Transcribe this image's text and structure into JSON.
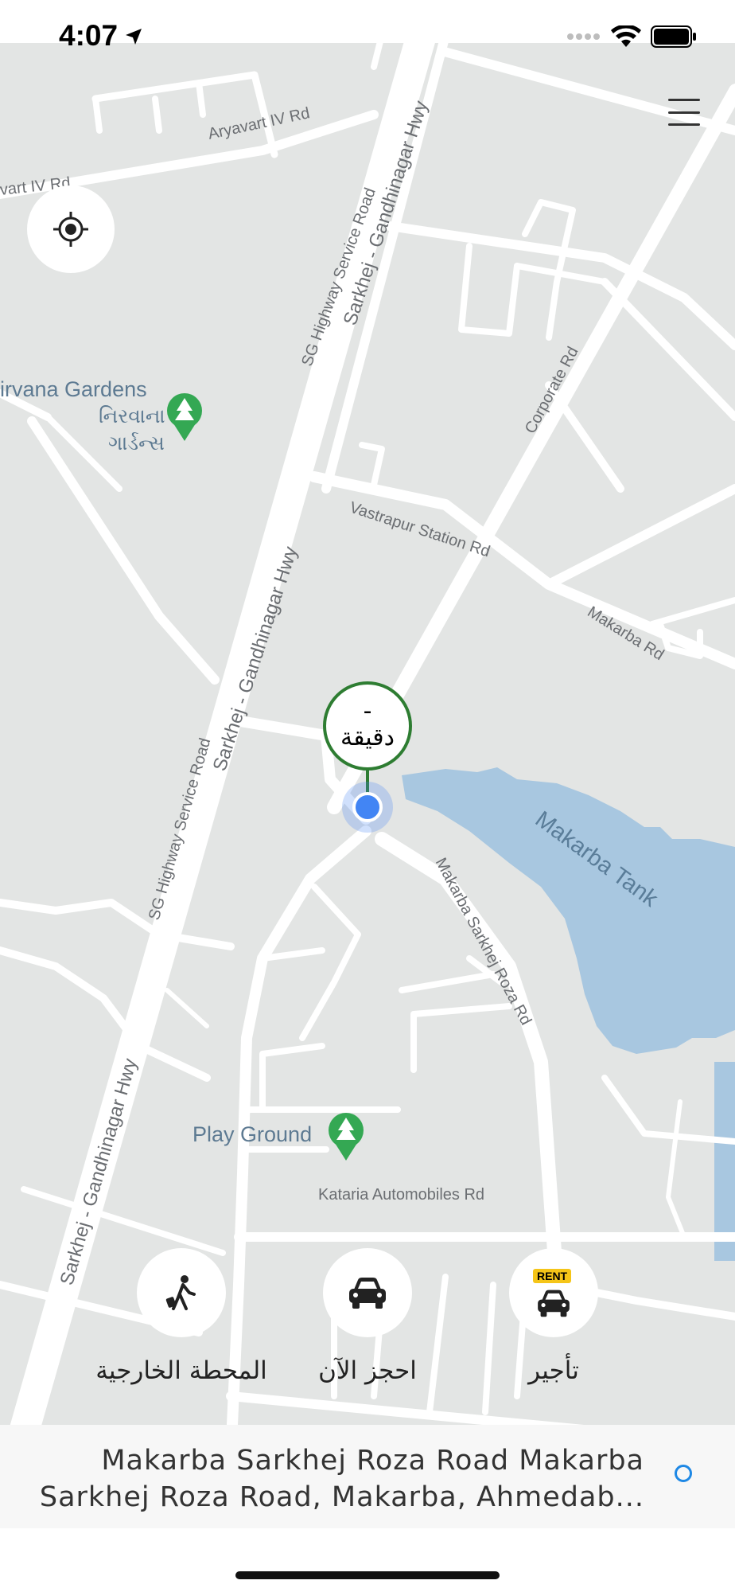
{
  "status_bar": {
    "time": "4:07"
  },
  "map": {
    "streets": [
      "Aryavart IV Rd",
      "vart IV Rd",
      "SG Highway Service Road",
      "Sarkhej - Gandhinagar Hwy",
      "Corporate Rd",
      "Vastrapur Station Rd",
      "Makarba Rd",
      "Makarba Sarkhej Roza Rd",
      "Kataria Automobiles Rd"
    ],
    "pois": {
      "gardens": "irvana Gardens",
      "gardens_gujarati_1": "નિરવાના",
      "gardens_gujarati_2": "ગાર્ડન્સ",
      "playground": "Play Ground"
    },
    "water": "Makarba Tank"
  },
  "eta": {
    "value": "-",
    "unit": "دقيقة"
  },
  "actions": [
    {
      "label": "المحطة الخارجية",
      "icon": "traveler-icon"
    },
    {
      "label": "احجز الآن",
      "icon": "car-icon"
    },
    {
      "label": "تأجير",
      "icon": "rent-car-icon",
      "badge": "RENT"
    }
  ],
  "address": {
    "line1": "Makarba Sarkhej Roza Road Makarba",
    "line2": "Sarkhej Roza Road, Makarba, Ahmedab..."
  },
  "colors": {
    "map_background": "#e3e5e4",
    "road": "#ffffff",
    "water": "#a8c7e0",
    "poi_green": "#34a853",
    "eta_green": "#2e7d32",
    "user_dot": "#4285f4"
  }
}
